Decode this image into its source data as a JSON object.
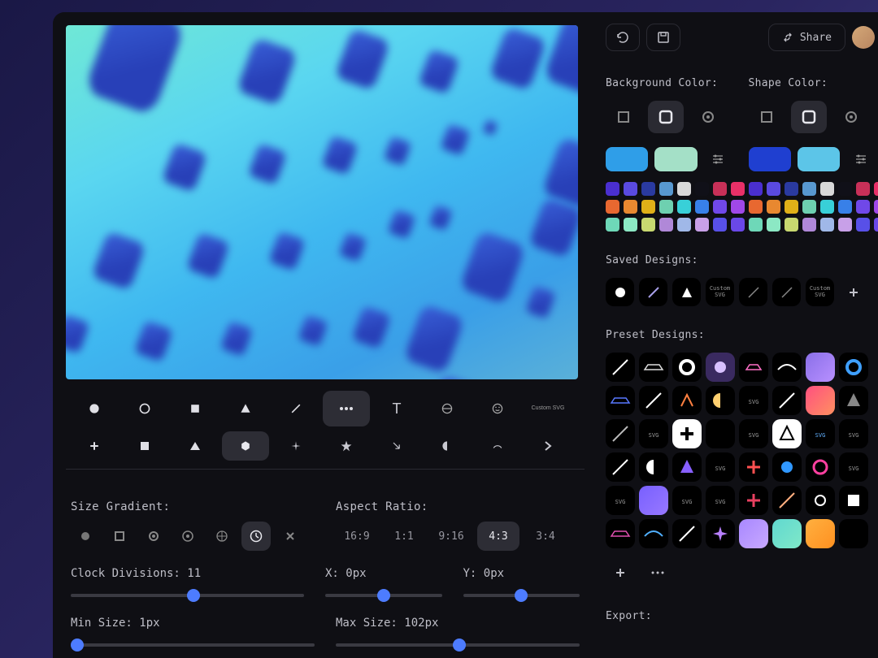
{
  "topbar": {
    "share_label": "Share"
  },
  "panels": {
    "bg_color_label": "Background Color:",
    "shape_color_label": "Shape Color:",
    "saved_designs_label": "Saved Designs:",
    "preset_designs_label": "Preset Designs:",
    "export_label": "Export:"
  },
  "controls": {
    "size_gradient_label": "Size Gradient:",
    "aspect_ratio_label": "Aspect Ratio:",
    "aspect_ratios": [
      "16:9",
      "1:1",
      "9:16",
      "4:3",
      "3:4"
    ],
    "aspect_selected": "4:3",
    "clock_divisions_label": "Clock Divisions:",
    "clock_divisions_value": 11,
    "x_label": "X:",
    "x_value": "0px",
    "y_label": "Y:",
    "y_value": "0px",
    "min_size_label": "Min Size:",
    "min_size_value": "1px",
    "max_size_label": "Max Size:",
    "max_size_value": "102px"
  },
  "bg_swatches": {
    "primary": "#2f9ee8",
    "secondary": "#a4e0c7"
  },
  "shape_swatches": {
    "primary": "#1f3fd0",
    "secondary": "#5cc5e8"
  },
  "palette": [
    "#4a2fd0",
    "#5a4ae0",
    "#2a3aa0",
    "#5898d0",
    "#d8d8d8",
    "#101018",
    "#c83058",
    "#e83068",
    "#e86830",
    "#e88830",
    "#e0b018",
    "#6ed0b0",
    "#38d0d8",
    "#3880e8",
    "#7048e8",
    "#a048e8",
    "#6ed8b8",
    "#8ce8c4",
    "#c8d870",
    "#b088d8",
    "#a0b8e8",
    "#c8a0e8",
    "#5850e8",
    "#6a48e8"
  ],
  "custom_svg_label": "Custom\nSVG",
  "size_gradient_options": [
    "dot",
    "square-outline",
    "circle-outline",
    "radial",
    "grid",
    "clock",
    "x"
  ]
}
